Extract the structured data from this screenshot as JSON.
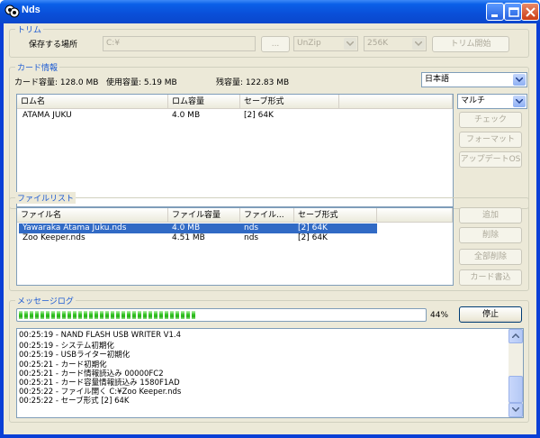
{
  "window": {
    "title": "Nds"
  },
  "trim": {
    "group_label": "トリム",
    "save_location_label": "保存する場所",
    "save_location_value": "C:¥",
    "browse_label": "...",
    "unzip_value": "UnZip",
    "size_value": "256K",
    "start_label": "トリム開始"
  },
  "card": {
    "group_label": "カード情報",
    "capacity_text": "カード容量: 128.0 MB",
    "used_text": "使用容量: 5.19 MB",
    "remaining_text": "残容量: 122.83 MB",
    "language_value": "日本語",
    "mode_value": "マルチ",
    "columns": [
      "ロム名",
      "ロム容量",
      "セーブ形式"
    ],
    "rows": [
      {
        "name": "ATAMA JUKU",
        "size": "4.0 MB",
        "save": "[2] 64K"
      }
    ],
    "buttons": {
      "check": "チェック",
      "format": "フォーマット",
      "update_os": "アップデートOS"
    }
  },
  "files": {
    "group_label": "ファイルリスト",
    "columns": [
      "ファイル名",
      "ファイル容量",
      "ファイル...",
      "セーブ形式"
    ],
    "rows": [
      {
        "name": "Yawaraka Atama Juku.nds",
        "size": "4.0 MB",
        "type": "nds",
        "save": "[2] 64K",
        "selected": true
      },
      {
        "name": "Zoo Keeper.nds",
        "size": "4.51 MB",
        "type": "nds",
        "save": "[2] 64K",
        "selected": false
      }
    ],
    "buttons": {
      "add": "追加",
      "delete": "削除",
      "delete_all": "全部削除",
      "write_card": "カード書込"
    }
  },
  "log": {
    "group_label": "メッセージログ",
    "progress_percent": 44,
    "progress_text": "44%",
    "stop_label": "停止",
    "lines": [
      "00:25:19 - NAND FLASH USB WRITER V1.4",
      "00:25:19 - システム初期化",
      "00:25:19 - USBライター初期化",
      "00:25:21 - カード初期化",
      "00:25:21 - カード情報読込み 00000FC2",
      "00:25:21 - カード容量情報読込み 1580F1AD",
      "00:25:22 - ファイル開く C:¥Zoo Keeper.nds",
      "00:25:22 - セーブ形式 [2] 64K"
    ]
  },
  "colors": {
    "titlebar": "#0a4fd8",
    "face": "#ece9d8",
    "group_label": "#1d5bd3",
    "selection": "#316ac5",
    "progress": "#31c421"
  }
}
